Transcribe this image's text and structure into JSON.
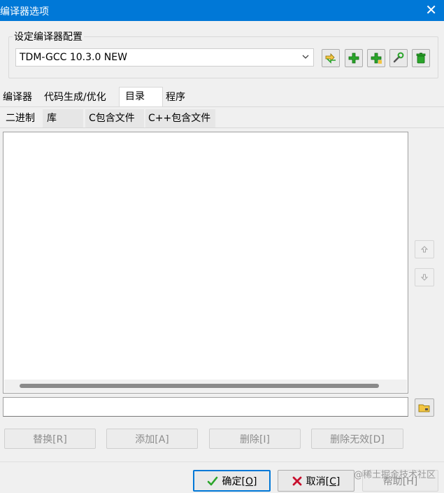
{
  "window": {
    "title": "编译器选项",
    "close_glyph": "✕"
  },
  "config_group": {
    "legend": "设定编译器配置",
    "selected_compiler": "TDM-GCC 10.3.0 NEW",
    "toolbar_icons": [
      "rename-icon",
      "add-icon",
      "add-icon",
      "wrench-icon",
      "delete-icon"
    ]
  },
  "tabs": [
    "编译器",
    "代码生成/优化",
    "目录",
    "程序"
  ],
  "active_tab": "目录",
  "subtabs": [
    "二进制",
    "库",
    "C包含文件",
    "C++包含文件"
  ],
  "active_subtab": "二进制",
  "path_input": {
    "value": ""
  },
  "actions": {
    "replace": "替换[R]",
    "add": "添加[A]",
    "delete": "删除[I]",
    "delete_invalid": "删除无效[D]"
  },
  "dialog_buttons": {
    "ok_text": "确定",
    "ok_key": "[O]",
    "cancel_text": "取消",
    "cancel_key": "[C]",
    "help": "帮助[H]"
  },
  "watermark": "@稀土掘金技术社区",
  "colors": {
    "titlebar": "#0078d7",
    "accent_green": "#2aa52a",
    "cancel_red": "#c8102e"
  }
}
